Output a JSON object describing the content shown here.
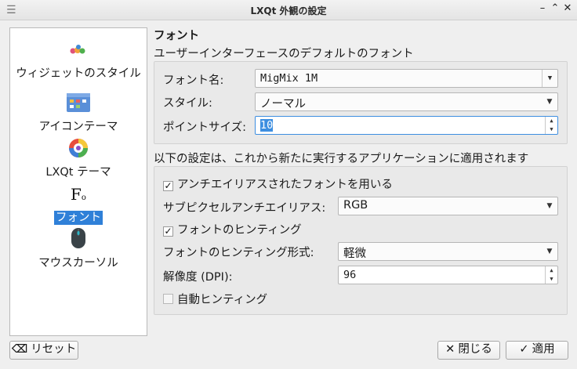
{
  "window": {
    "title": "LXQt 外観の設定",
    "controls": {
      "minimize": "–",
      "restore": "⌃",
      "close": "✕"
    }
  },
  "sidebar": {
    "items": [
      {
        "label": "ウィジェットのスタイル",
        "icon": "widget-style-icon"
      },
      {
        "label": "アイコンテーマ",
        "icon": "icon-theme-icon"
      },
      {
        "label": "LXQt テーマ",
        "icon": "lxqt-theme-icon"
      },
      {
        "label": "フォント",
        "icon": "font-icon",
        "selected": true
      },
      {
        "label": "マウスカーソル",
        "icon": "mouse-cursor-icon"
      }
    ],
    "font_icon_glyph": "F",
    "font_icon_sub": "o"
  },
  "page": {
    "title": "フォント",
    "subtitle": "ユーザーインターフェースのデフォルトのフォント",
    "font_name_label": "フォント名:",
    "font_name_value": "MigMix 1M",
    "style_label": "スタイル:",
    "style_value": "ノーマル",
    "point_size_label": "ポイントサイズ:",
    "point_size_value": "10",
    "apply_note": "以下の設定は、これから新たに実行するアプリケーションに適用されます",
    "antialias_label": "アンチエイリアスされたフォントを用いる",
    "antialias_checked": true,
    "subpixel_label": "サブピクセルアンチエイリアス:",
    "subpixel_value": "RGB",
    "hinting_label": "フォントのヒンティング",
    "hinting_checked": true,
    "hinting_style_label": "フォントのヒンティング形式:",
    "hinting_style_value": "軽微",
    "dpi_label": "解像度 (DPI):",
    "dpi_value": "96",
    "autohint_label": "自動ヒンティング",
    "autohint_checked": false
  },
  "buttons": {
    "reset": "リセット",
    "close": "閉じる",
    "apply": "適用"
  },
  "colors": {
    "selection": "#2f80d8",
    "focus": "#3d8ee0"
  }
}
